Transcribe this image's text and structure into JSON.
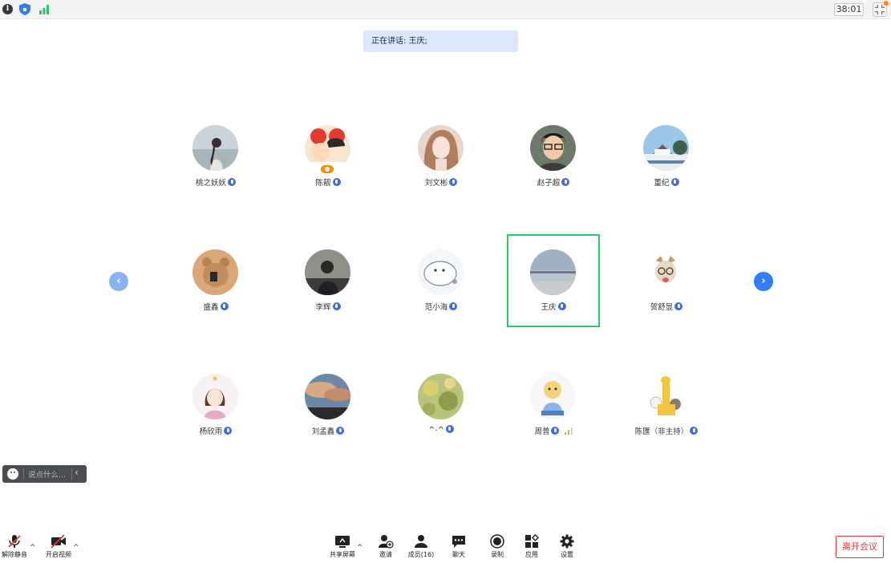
{
  "topbar": {
    "info_icon": "info-icon",
    "shield_icon": "shield-icon",
    "signal_icon": "signal-icon",
    "timer": "38:01",
    "collapse_icon": "fullscreen-exit-icon"
  },
  "speaking": {
    "label": "正在讲话: 王庆;"
  },
  "participants": [
    {
      "name": "桃之妖妖"
    },
    {
      "name": "陈靓"
    },
    {
      "name": "刘文彬"
    },
    {
      "name": "赵子超"
    },
    {
      "name": "董纪"
    },
    {
      "name": "盛鑫"
    },
    {
      "name": "李辉"
    },
    {
      "name": "范小海"
    },
    {
      "name": "王庆"
    },
    {
      "name": "贺舒显"
    },
    {
      "name": "杨欣雨"
    },
    {
      "name": "刘孟鑫"
    },
    {
      "name": "^-^"
    },
    {
      "name": "周普"
    },
    {
      "name": "陈匯（非主持）"
    }
  ],
  "nav": {
    "prev": "‹",
    "next": "›"
  },
  "chat": {
    "placeholder": "说点什么...",
    "collapse": "‹"
  },
  "toolbar": {
    "unmute": "解除静音",
    "start_video": "开启视频",
    "share_screen": "共享屏幕",
    "invite": "邀请",
    "members": "成员(16)",
    "chat": "聊天",
    "record": "录制",
    "apps": "应用",
    "settings": "设置",
    "leave": "离开会议"
  },
  "colors": {
    "accent": "#2f7cf6",
    "active_border": "#2ec56a",
    "leave": "#e53935",
    "host_badge": "#ff8a00"
  }
}
